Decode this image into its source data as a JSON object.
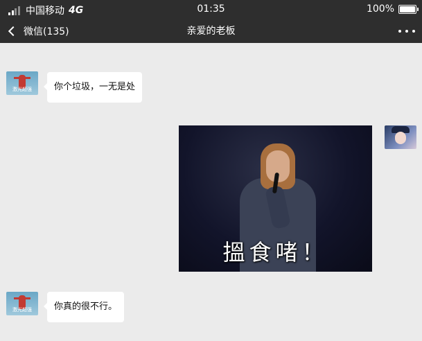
{
  "status_bar": {
    "carrier": "中国移动",
    "network": "4G",
    "time": "01:35",
    "battery": "100%"
  },
  "nav": {
    "back_label": "微信(135)",
    "title": "亲爱的老板"
  },
  "messages": [
    {
      "side": "left",
      "type": "text",
      "text": "你个垃圾，一无是处"
    },
    {
      "side": "right",
      "type": "sticker",
      "caption": "搵食啫！"
    },
    {
      "side": "left",
      "type": "text",
      "text": "你真的很不行。"
    }
  ],
  "avatars": {
    "left_caption": "激光超强"
  },
  "colors": {
    "bar_bg": "#2e2e2e",
    "chat_bg": "#ebebeb",
    "bubble_bg": "#ffffff"
  }
}
